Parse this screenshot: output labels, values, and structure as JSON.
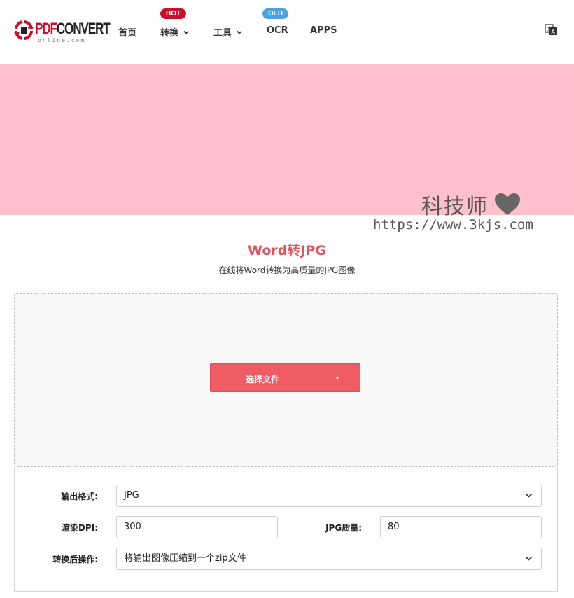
{
  "header": {
    "logo": {
      "brand_prefix": "PDF",
      "brand_suffix": "CONVERT",
      "subtext": "online.com"
    },
    "nav": [
      {
        "label": "首页"
      },
      {
        "label": "转换",
        "badge": "HOT",
        "has_dropdown": true
      },
      {
        "label": "工具",
        "has_dropdown": true
      },
      {
        "label": "OCR",
        "badge": "OLD"
      },
      {
        "label": "APPS"
      }
    ],
    "language_icon": "translate-icon"
  },
  "watermark": {
    "title": "科技师",
    "url": "https://www.3kjs.com",
    "icon": "heart-icon"
  },
  "main": {
    "title": "Word转JPG",
    "subtitle": "在线将Word转换为高质量的JPG图像",
    "choose_file_label": "选择文件"
  },
  "options": {
    "output_format": {
      "label": "输出格式:",
      "value": "JPG"
    },
    "render_dpi": {
      "label": "渲染DPI:",
      "value": "300"
    },
    "jpg_quality": {
      "label": "JPG质量:",
      "value": "80"
    },
    "post_action": {
      "label": "转换后操作:",
      "value": "将输出图像压缩到一个zip文件"
    }
  },
  "colors": {
    "banner": "#ffc0cb",
    "accent": "#ef5c64",
    "title": "#e0535f",
    "hot_badge": "#c8102e",
    "old_badge": "#4aa3df"
  }
}
